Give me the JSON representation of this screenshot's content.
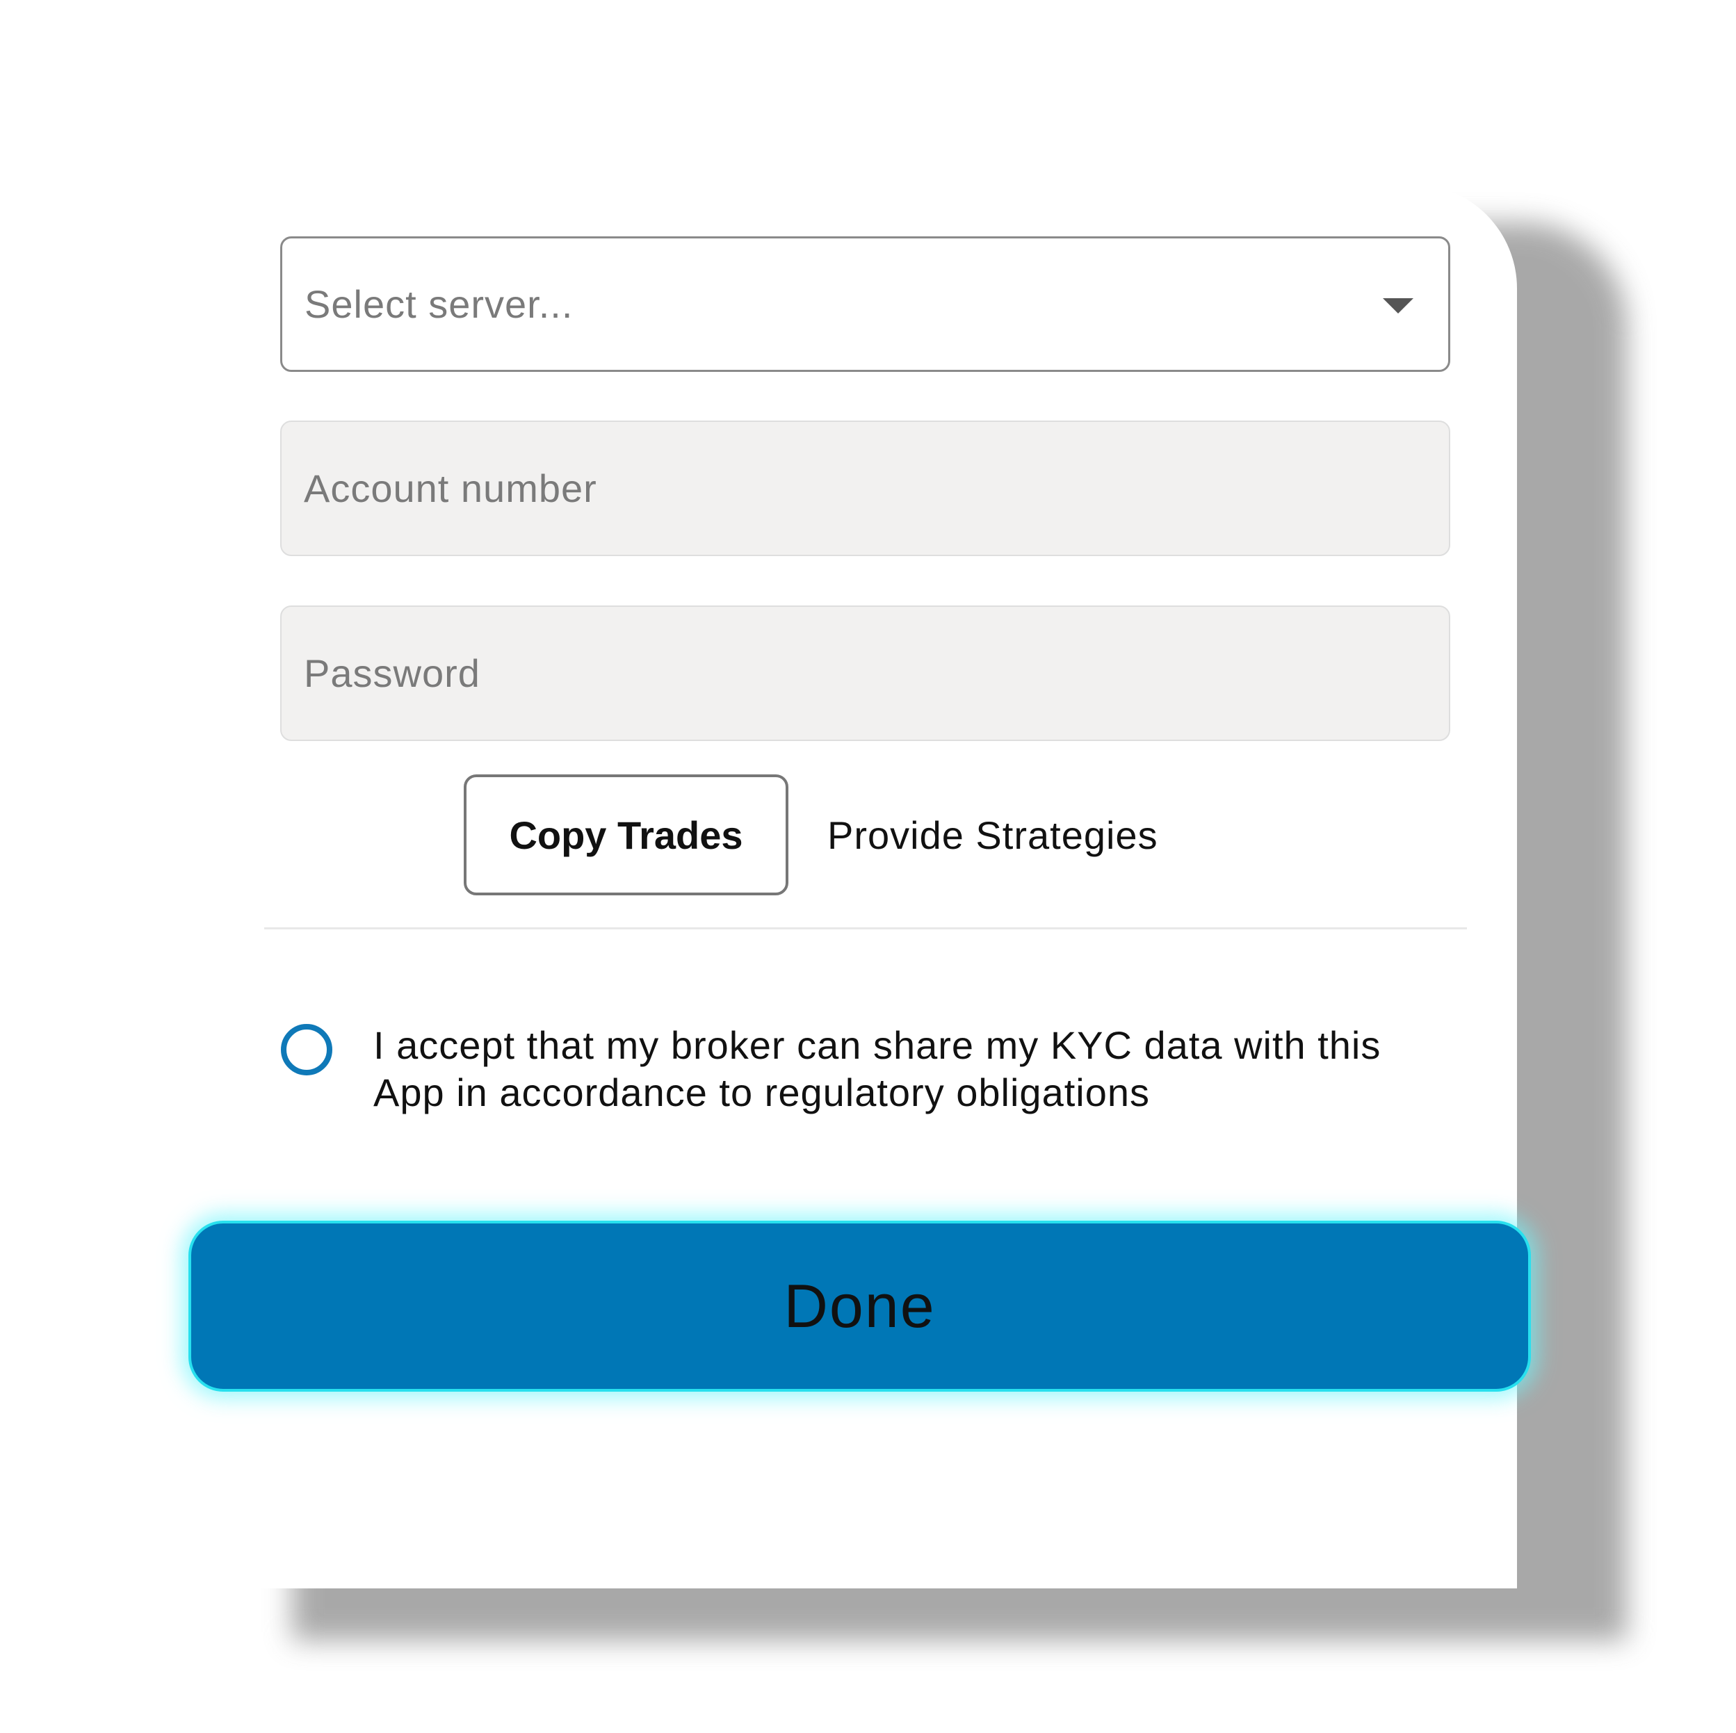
{
  "form": {
    "server_select": {
      "placeholder": "Select server..."
    },
    "account_number": {
      "placeholder": "Account number",
      "value": ""
    },
    "password": {
      "placeholder": "Password",
      "value": ""
    }
  },
  "tabs": [
    {
      "label": "Copy Trades",
      "selected": true
    },
    {
      "label": "Provide Strategies",
      "selected": false
    }
  ],
  "consent": {
    "text": "I accept that my broker can share my KYC data with this App in accordance to regulatory obligations",
    "checked": false
  },
  "actions": {
    "done_label": "Done"
  },
  "icons": {
    "select_caret": "chevron-down-icon",
    "consent_radio": "radio-unchecked-icon"
  },
  "colors": {
    "primary": "#0077b6",
    "glow": "#28e0ee",
    "radio_border": "#0f79b8",
    "input_fill": "#f2f1f0"
  }
}
